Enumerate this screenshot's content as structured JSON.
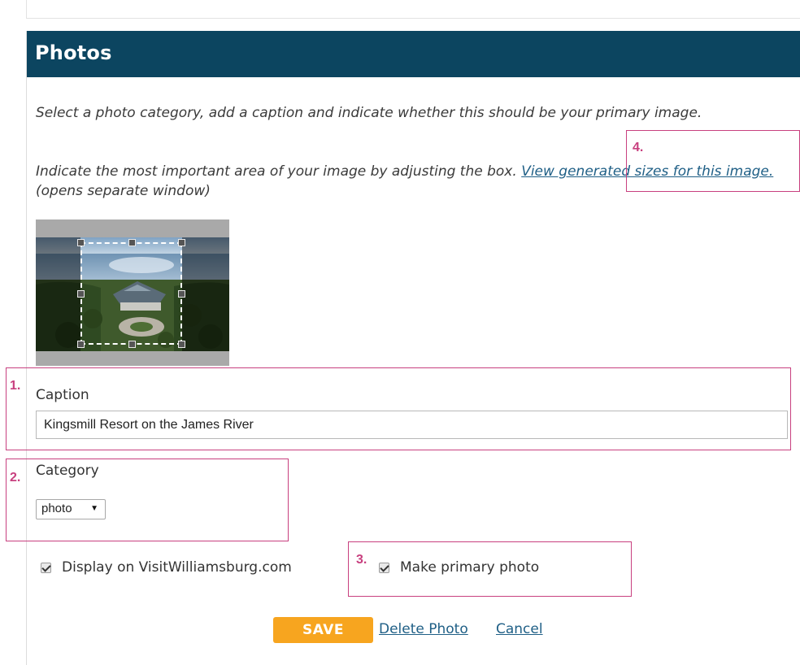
{
  "panel": {
    "title": "Photos",
    "instruction_1": "Select a photo category, add a caption and indicate whether this should be your primary image.",
    "instruction_2_prefix": "Indicate the most important area of your image by adjusting the box.",
    "view_sizes_link": "View generated sizes for this image.",
    "instruction_2_suffix": "(opens separate window)"
  },
  "caption": {
    "label": "Caption",
    "value": "Kingsmill Resort on the James River"
  },
  "category": {
    "label": "Category",
    "selected": "photo"
  },
  "options": {
    "display_label": "Display on VisitWilliamsburg.com",
    "display_checked": true,
    "primary_label": "Make primary photo",
    "primary_checked": true
  },
  "actions": {
    "save_label": "SAVE",
    "delete_label": "Delete Photo",
    "cancel_label": "Cancel"
  },
  "annotations": [
    "1.",
    "2.",
    "3.",
    "4."
  ],
  "colors": {
    "header": "#0c4560",
    "save": "#f7a51f",
    "link": "#1f5f86",
    "annotation": "#c8407f"
  }
}
